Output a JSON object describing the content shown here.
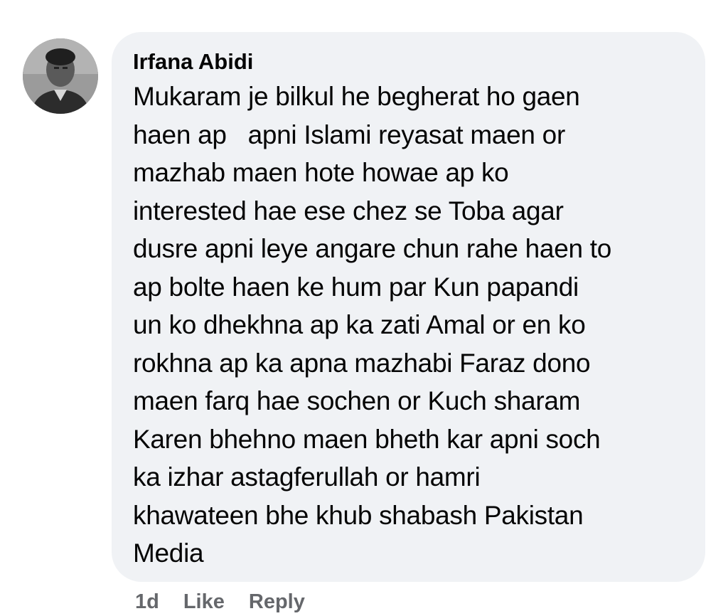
{
  "comment": {
    "author": "Irfana Abidi",
    "text_lines": [
      "Mukaram je bilkul he begherat ho gaen",
      "haen ap   apni Islami reyasat maen or",
      "mazhab maen hote howae ap ko",
      "interested hae ese chez se Toba agar",
      "dusre apni leye angare chun rahe haen to",
      "ap bolte haen ke hum par Kun papandi",
      "un ko dhekhna ap ka zati Amal or en ko",
      "rokhna ap ka apna mazhabi Faraz dono",
      "maen farq hae sochen or Kuch sharam",
      "Karen bhehno maen bheth kar apni soch",
      "ka izhar astagferullah or hamri",
      "khawateen bhe khub shabash Pakistan",
      "Media"
    ]
  },
  "actions": {
    "time": "1d",
    "like_label": "Like",
    "reply_label": "Reply"
  },
  "colors": {
    "bubble_background": "#f0f2f5",
    "text": "#050505",
    "meta_text": "#65676b"
  }
}
